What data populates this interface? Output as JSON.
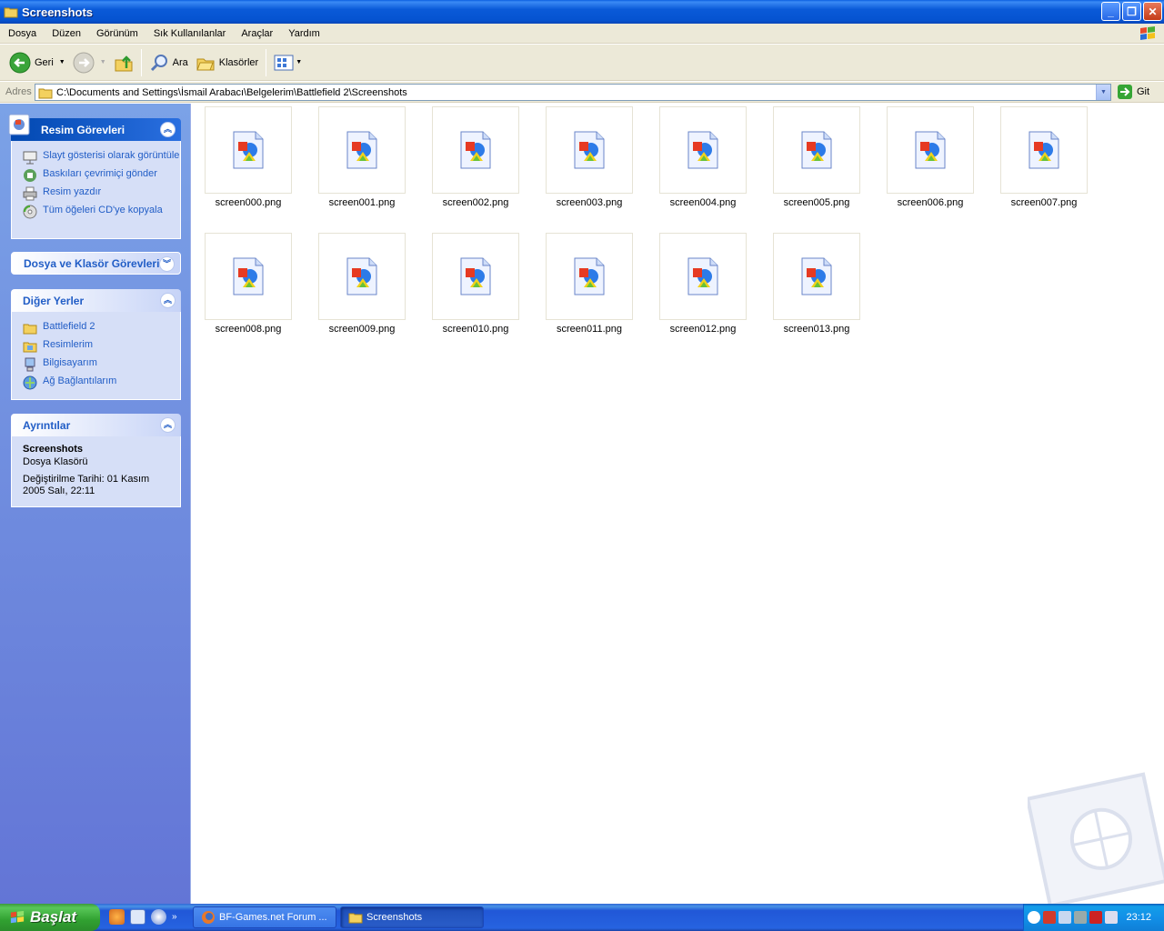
{
  "window": {
    "title": "Screenshots"
  },
  "menu": [
    "Dosya",
    "Düzen",
    "Görünüm",
    "Sık Kullanılanlar",
    "Araçlar",
    "Yardım"
  ],
  "toolbar": {
    "back": "Geri",
    "search": "Ara",
    "folders": "Klasörler"
  },
  "address": {
    "label": "Adres",
    "path": "C:\\Documents and Settings\\İsmail Arabacı\\Belgelerim\\Battlefield 2\\Screenshots",
    "go": "Git"
  },
  "panels": {
    "picture_tasks": {
      "title": "Resim Görevleri",
      "items": [
        "Slayt gösterisi olarak görüntüle",
        "Baskıları çevrimiçi gönder",
        "Resim yazdır",
        "Tüm öğeleri CD'ye kopyala"
      ]
    },
    "file_tasks": {
      "title": "Dosya ve Klasör Görevleri"
    },
    "other_places": {
      "title": "Diğer Yerler",
      "items": [
        "Battlefield 2",
        "Resimlerim",
        "Bilgisayarım",
        "Ağ Bağlantılarım"
      ]
    },
    "details": {
      "title": "Ayrıntılar",
      "name": "Screenshots",
      "type": "Dosya Klasörü",
      "modified": "Değiştirilme Tarihi: 01 Kasım 2005 Salı, 22:11"
    }
  },
  "files": [
    "screen000.png",
    "screen001.png",
    "screen002.png",
    "screen003.png",
    "screen004.png",
    "screen005.png",
    "screen006.png",
    "screen007.png",
    "screen008.png",
    "screen009.png",
    "screen010.png",
    "screen011.png",
    "screen012.png",
    "screen013.png"
  ],
  "taskbar": {
    "start": "Başlat",
    "tasks": [
      "BF-Games.net Forum ...",
      "Screenshots"
    ],
    "clock": "23:12"
  },
  "colors": {
    "title_blue": "#0553d0",
    "pane_blue": "#6375d6",
    "link_blue": "#215dc6",
    "start_green": "#31a131"
  }
}
